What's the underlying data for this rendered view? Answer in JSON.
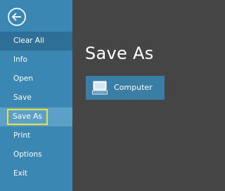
{
  "sidebar": {
    "back_icon": "back-arrow-icon",
    "items": [
      {
        "label": "Clear All"
      },
      {
        "label": "Info"
      },
      {
        "label": "Open"
      },
      {
        "label": "Save"
      },
      {
        "label": "Save As"
      },
      {
        "label": "Print"
      },
      {
        "label": "Options"
      },
      {
        "label": "Exit"
      }
    ],
    "selected_item": "Save As",
    "colors": {
      "sidebar": "#3a87b3",
      "highlight_border": "#ebe13c"
    }
  },
  "main": {
    "title": "Save As",
    "locations": [
      {
        "label": "Computer",
        "icon": "computer-icon"
      }
    ],
    "colors": {
      "background": "#454545",
      "tile": "#3a7ea6"
    }
  }
}
